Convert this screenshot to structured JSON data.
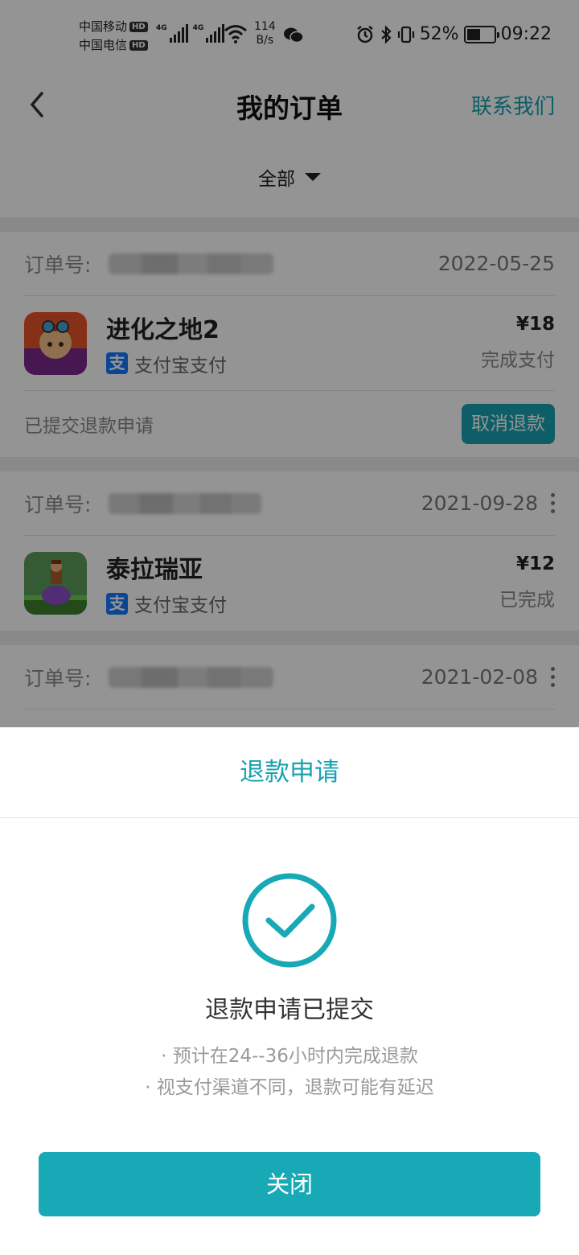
{
  "status_bar": {
    "carrier1": "中国移动",
    "carrier2": "中国电信",
    "hd": "HD",
    "net1": "4G",
    "net2": "4G",
    "speed_value": "114",
    "speed_unit": "B/s",
    "battery_percent": "52%",
    "battery_level": 0.52,
    "time": "09:22"
  },
  "header": {
    "title": "我的订单",
    "contact": "联系我们"
  },
  "filter": {
    "label": "全部"
  },
  "orders": [
    {
      "order_label": "订单号:",
      "date": "2022-05-25",
      "app_name": "进化之地2",
      "payment": "支付宝支付",
      "price": "¥18",
      "status": "完成支付",
      "refund_state": "已提交退款申请",
      "action": "取消退款"
    },
    {
      "order_label": "订单号:",
      "date": "2021-09-28",
      "app_name": "泰拉瑞亚",
      "payment": "支付宝支付",
      "price": "¥12",
      "status": "已完成"
    },
    {
      "order_label": "订单号:",
      "date": "2021-02-08"
    }
  ],
  "sheet": {
    "title": "退款申请",
    "message": "退款申请已提交",
    "note1": "· 预计在24--36小时内完成退款",
    "note2": "· 视支付渠道不同，退款可能有延迟",
    "close": "关闭"
  },
  "colors": {
    "accent": "#17a3b0",
    "button": "#17a9b5",
    "alipay": "#1677ff"
  }
}
